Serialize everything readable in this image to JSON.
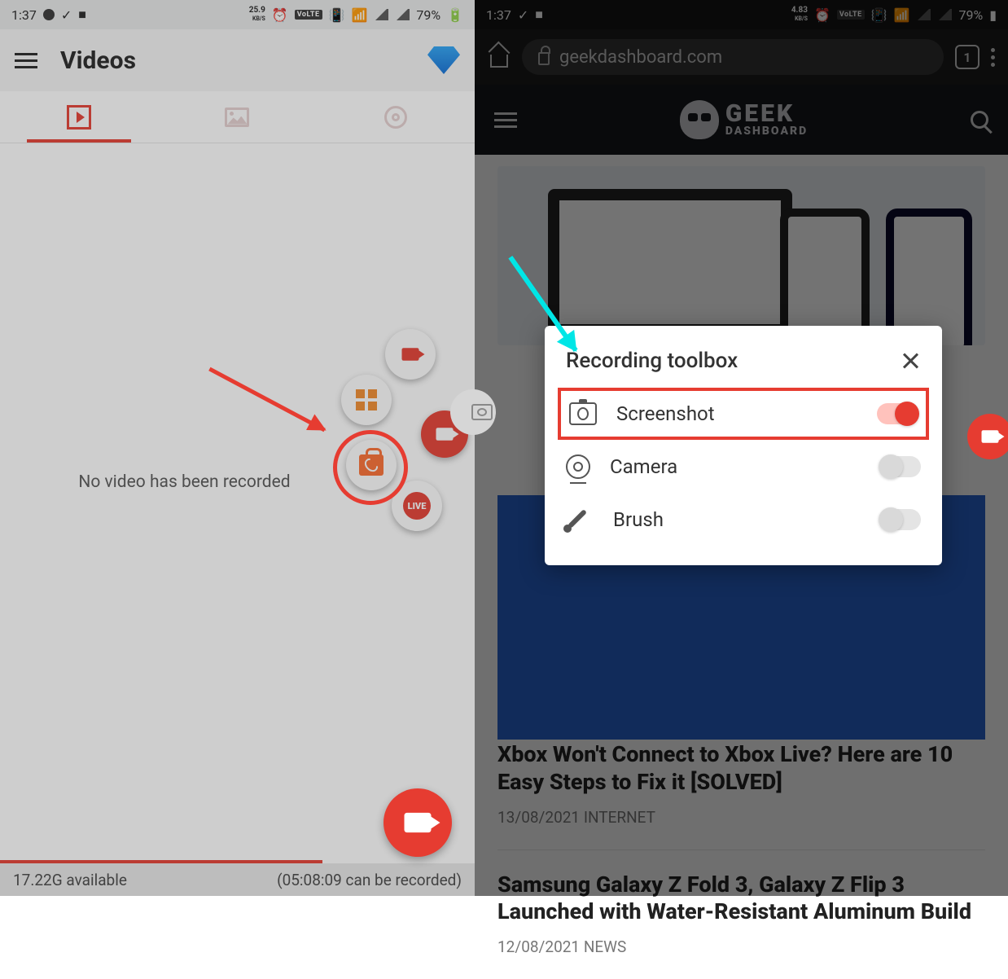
{
  "left": {
    "status": {
      "time": "1:37",
      "data_rate": "25.9",
      "data_unit": "KB/S",
      "volte": "VoLTE",
      "battery": "79%"
    },
    "header": {
      "title": "Videos"
    },
    "empty_message": "No video has been recorded",
    "live_badge": "LIVE",
    "footer": {
      "storage": "17.22G available",
      "time_left": "(05:08:09 can be recorded)"
    }
  },
  "right": {
    "status": {
      "time": "1:37",
      "data_rate": "4.83",
      "data_unit": "KB/S",
      "volte": "VoLTE",
      "battery": "79%"
    },
    "browser": {
      "url": "geekdashboard.com",
      "tab_count": "1"
    },
    "brand": {
      "line1": "GEEK",
      "line2": "DASHBOARD"
    },
    "modal": {
      "title": "Recording toolbox",
      "rows": [
        {
          "label": "Screenshot",
          "on": true
        },
        {
          "label": "Camera",
          "on": false
        },
        {
          "label": "Brush",
          "on": false
        }
      ]
    },
    "articles": [
      {
        "title": "Xbox Won't Connect to Xbox Live? Here are 10 Easy Steps to Fix it [SOLVED]",
        "meta": "13/08/2021 INTERNET"
      },
      {
        "title": "Samsung Galaxy Z Fold 3, Galaxy Z Flip 3 Launched with Water-Resistant Aluminum Build",
        "meta": "12/08/2021 NEWS"
      }
    ]
  }
}
